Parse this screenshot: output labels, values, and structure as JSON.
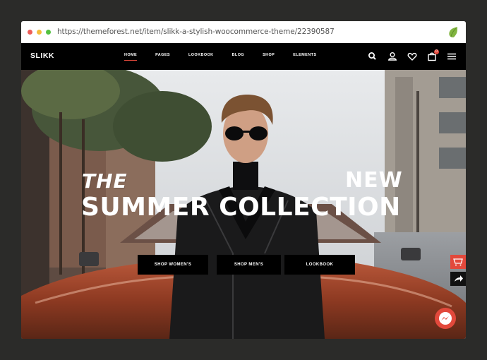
{
  "browser": {
    "url": "https://themeforest.net/item/slikk-a-stylish-woocommerce-theme/22390587"
  },
  "header": {
    "brand": "SLIKK",
    "menu": [
      {
        "label": "HOME",
        "active": true
      },
      {
        "label": "PAGES",
        "active": false
      },
      {
        "label": "LOOKBOOK",
        "active": false
      },
      {
        "label": "BLOG",
        "active": false
      },
      {
        "label": "SHOP",
        "active": false
      },
      {
        "label": "ELEMENTS",
        "active": false
      }
    ],
    "icons": [
      "search-icon",
      "user-icon",
      "heart-icon",
      "cart-icon",
      "hamburger-icon"
    ],
    "cart_count": "0"
  },
  "hero": {
    "line_the": "THE",
    "line_new": "NEW",
    "line_main": "SUMMER COLLECTION",
    "buttons": [
      "SHOP WOMEN'S",
      "SHOP MEN'S",
      "LOOKBOOK"
    ]
  },
  "colors": {
    "accent": "#e2493c",
    "nav_bg": "#000000",
    "page_bg": "#2b2b29"
  }
}
